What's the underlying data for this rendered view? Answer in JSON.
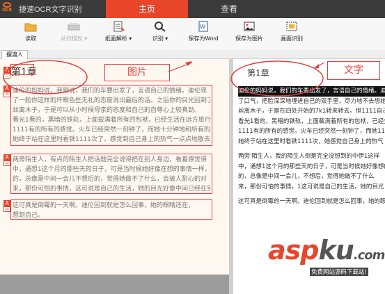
{
  "app": {
    "title": "捷速OCR文字识别",
    "logo_text": "OCR"
  },
  "tabs": [
    {
      "label": "主页",
      "active": true
    },
    {
      "label": "查看",
      "active": false
    }
  ],
  "toolbar": {
    "read": "读取",
    "scanner": "从扫描仪 ▾",
    "layout": "纸面解析 ▾",
    "recognize": "识别 ▾",
    "save_word": "保存为Word",
    "save_image": "保存为图片",
    "region": "画面识别"
  },
  "file_tab": "摆渡人",
  "left": {
    "chapter": "第1章",
    "flag_label": "A",
    "flag_sub": "三",
    "para1": [
      "  迪伦的妈妈说，我刚说，我们的车要出发了，言语自己的情绪。迪伦现",
      "了一脸你这样的坏眼色些无礼的态度说出最后的话。之后你的目光回到了",
      "丝离木子，于是可以从小时候母亲的态度和自己的自尊心上较真劲。",
      "看光1看的，黑暗的铁轨，上面载满着所有的包袱，已经生活在远方旅行",
      "1111有的所有的感觉。火车已经突然一刻钟了，而她十分钟地和所有的那人",
      "  她终于站在这里时看铁1111次了，感觉到自己身上的热气一点点地散去，不",
      "觉中间脚在鞋中，感觉凉凉的。"
    ],
    "para2": [
      "  两旁陌生人，有点的陌生人把话题完全说得把在别人身边，看着感觉得",
      "中，通想1这个月的那些天的日子，可是当时候她好像在想的事情一样，",
      "的，总像是中间一会儿不想后的，觉得她做不了什么，会被人耐心的对",
      "来，那份可怕的事情，这可说是自己的生活，她的目光好像中间已经在另",
      "一个世界里游走，她知道有人在等待着她。"
    ],
    "para3": [
      "  这可真是倒霉的一天啊。迪伦回到就是怎么回事，她的眼睛还在，",
      "想到自己。"
    ]
  },
  "right": {
    "chapter": "第1章",
    "lines": [
      "        迪伦的妈妈说，我们的车要出发了，言语自己的情绪。迪伦现",
      "了口气，把脸深深地埋进自己的双手里，尽力地不去想她的",
      "丝离木子，于是在四处开始的7k1转来转去。但1111自己的",
      "看光1看的，黑暗的铁轨，上面载满着所有的包袱，已经生",
      "1111有的所有的感觉。火车已经突然一刻钟了，而她11分钟",
      "        她终于站在这里时看铁1111次，她感觉自己身上的热气",
      "",
      "        两旁'陌生人，我的陌生人倒是完全没想到的中伊1这样",
      "中，通想1这个月的那些天的日子，可是当时候她好像想的",
      "的，总像是中间一会儿，不想后，觉得她做不了什么",
      "来，那份可怕的事情，1这可说是自己的生活，她的目光",
      "",
      "        这可真是倒霉的一天啊。迪伦回到就是怎么回事，她的眼睛"
    ]
  },
  "annotations": {
    "image_label": "图片",
    "text_label": "文字"
  },
  "watermark": {
    "brand_a": "asp",
    "brand_b": "ku",
    "suffix": ".com",
    "sub": "免费网站源码下载站!"
  },
  "colors": {
    "accent": "#e8462b",
    "title_bg": "#3a3a3a",
    "annotation": "#e54040"
  }
}
